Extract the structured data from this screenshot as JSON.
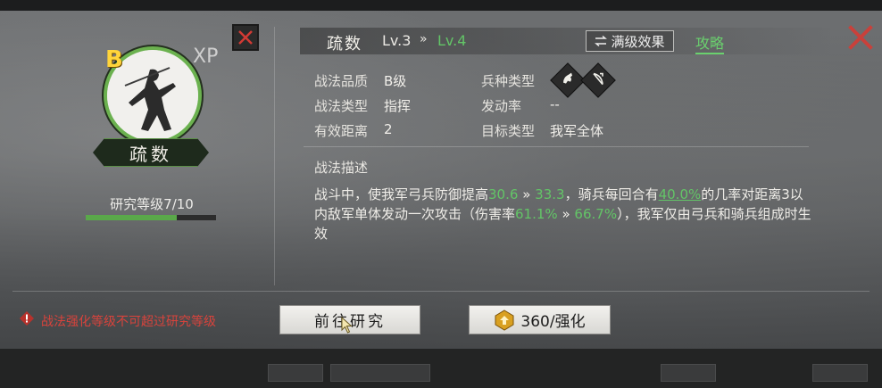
{
  "skill": {
    "name": "疏数",
    "grade_badge": "B",
    "xp_badge": "XP",
    "research_level_label": "研究等级",
    "research_level_value": "7/10",
    "research_progress": 0.7
  },
  "header": {
    "tab_name": "疏数",
    "level_current": "Lv.3",
    "level_arrow": "»",
    "level_next": "Lv.4",
    "max_effect_label": "满级效果",
    "guide_label": "攻略"
  },
  "attributes": {
    "quality_label": "战法品质",
    "quality_value": "B级",
    "troop_type_label": "兵种类型",
    "skill_type_label": "战法类型",
    "skill_type_value": "指挥",
    "trigger_rate_label": "发动率",
    "trigger_rate_value": "--",
    "range_label": "有效距离",
    "range_value": "2",
    "target_label": "目标类型",
    "target_value": "我军全体"
  },
  "description": {
    "title": "战法描述",
    "p1": "战斗中，使我军弓兵防御提高",
    "v1": "30.6",
    "arrow": "»",
    "v2": "33.3",
    "p2": "，骑兵每回合有",
    "v3": "40.0%",
    "p3": "的几率对距离3以内敌军单体发动一次攻击（伤害率",
    "v4": "61.1%",
    "v5": "66.7%",
    "p4": "），我军仅由弓兵和骑兵组成时生效"
  },
  "footer": {
    "warning": "战法强化等级不可超过研究等级",
    "research_button": "前往研究",
    "enhance_button": "360/强化"
  },
  "colors": {
    "accent_green": "#63c567",
    "warning_red": "#d8433c",
    "grade_gold": "#ffd43a"
  },
  "icons": [
    "close-icon",
    "swap-icon",
    "cavalry-icon",
    "archer-icon",
    "warning-icon",
    "enhance-icon",
    "cursor-icon"
  ]
}
